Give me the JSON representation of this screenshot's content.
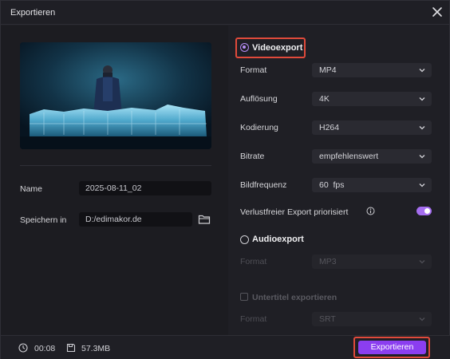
{
  "window": {
    "title": "Exportieren"
  },
  "left": {
    "name_label": "Name",
    "name_value": "2025-08-11_02",
    "save_label": "Speichern in",
    "save_value": "D:/edimakor.de"
  },
  "video_export": {
    "title": "Videoexport",
    "selected": true,
    "format": {
      "label": "Format",
      "value": "MP4"
    },
    "resolution": {
      "label": "Auflösung",
      "value": "4K"
    },
    "encoding": {
      "label": "Kodierung",
      "value": "H264"
    },
    "bitrate": {
      "label": "Bitrate",
      "value": "empfehlenswert"
    },
    "framerate": {
      "label": "Bildfrequenz",
      "value": "60  fps"
    },
    "lossless": {
      "label": "Verlustfreier Export priorisiert",
      "enabled": true
    }
  },
  "audio_export": {
    "title": "Audioexport",
    "selected": false,
    "format": {
      "label": "Format",
      "value": "MP3"
    }
  },
  "subtitle_export": {
    "title": "Untertitel exportieren",
    "checked": false,
    "format": {
      "label": "Format",
      "value": "SRT"
    }
  },
  "footer": {
    "duration": "00:08",
    "size": "57.3MB",
    "export_label": "Exportieren"
  },
  "colors": {
    "accent": "#8b3ef0",
    "highlight": "#e04a3b"
  }
}
